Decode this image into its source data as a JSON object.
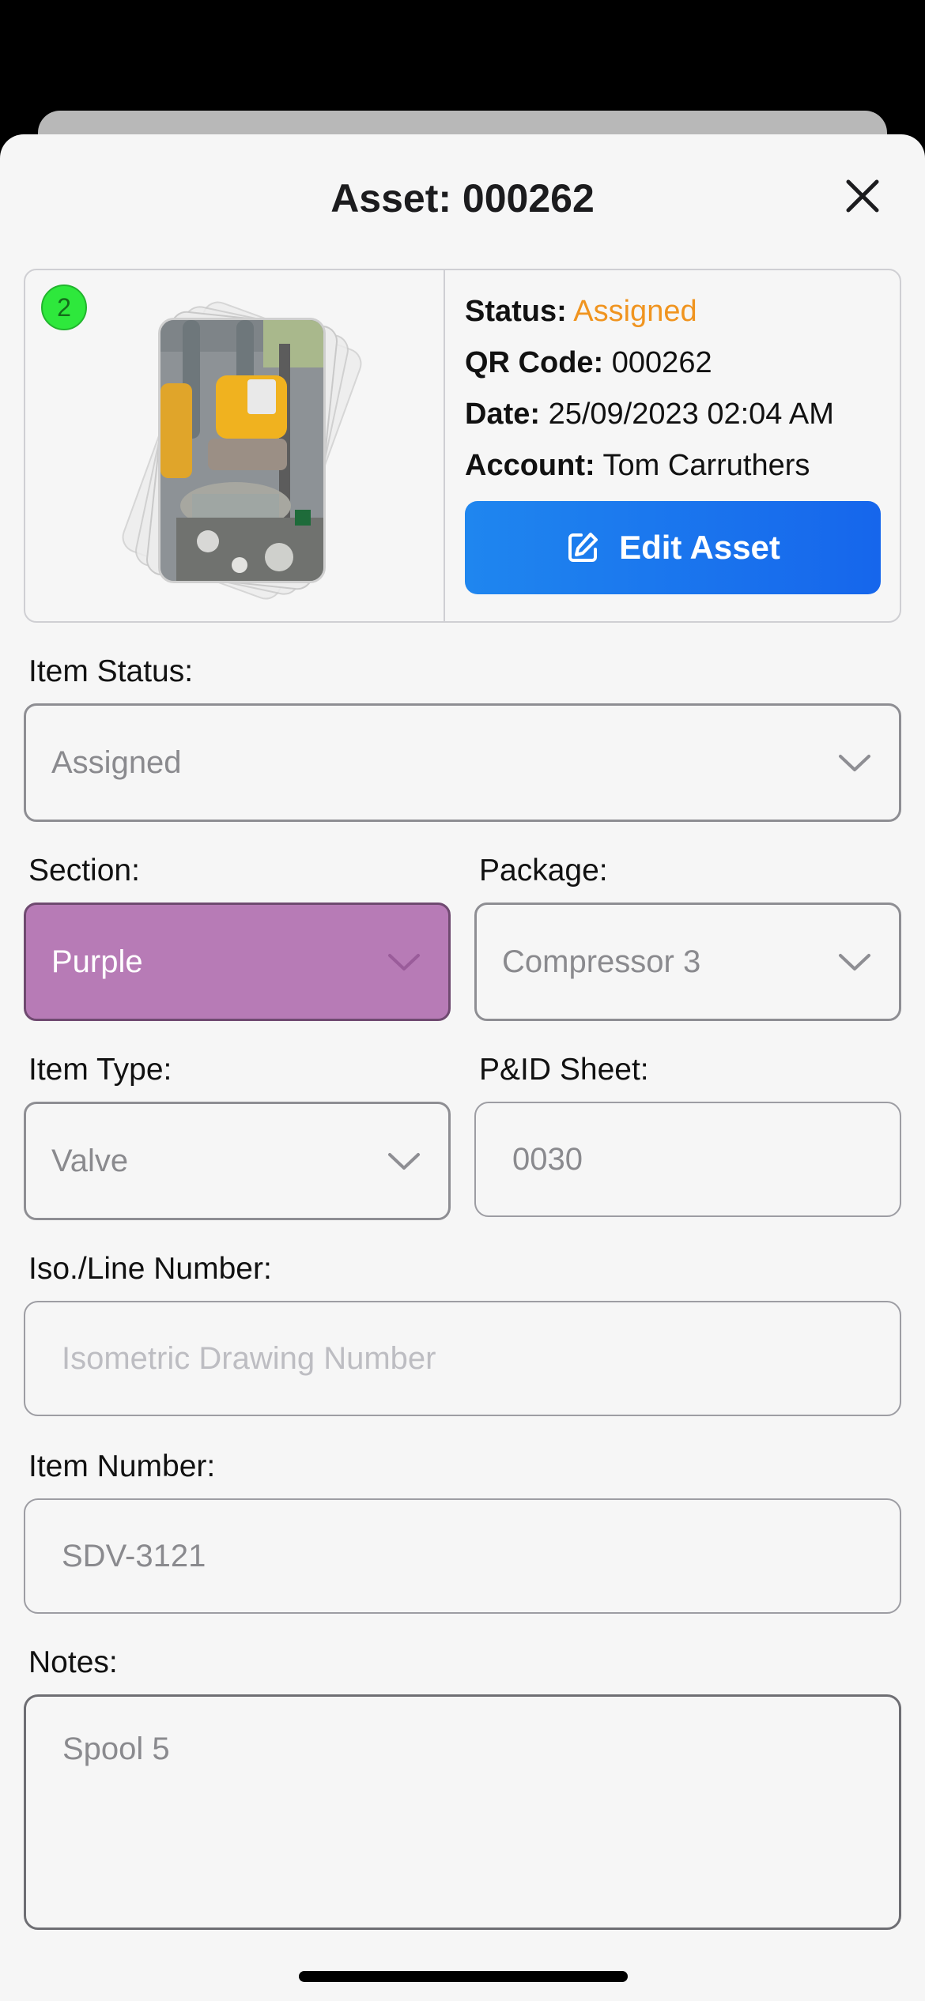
{
  "header": {
    "title": "Asset: 000262"
  },
  "asset_card": {
    "photo_count": "2",
    "status_label": "Status:",
    "status_value": "Assigned",
    "qr_label": "QR Code:",
    "qr_value": "000262",
    "date_label": "Date:",
    "date_value": "25/09/2023 02:04 AM",
    "account_label": "Account:",
    "account_value": "Tom Carruthers",
    "edit_button": "Edit Asset"
  },
  "form": {
    "item_status": {
      "label": "Item Status:",
      "value": "Assigned"
    },
    "section": {
      "label": "Section:",
      "value": "Purple"
    },
    "package": {
      "label": "Package:",
      "value": "Compressor 3"
    },
    "item_type": {
      "label": "Item Type:",
      "value": "Valve"
    },
    "pid_sheet": {
      "label": "P&ID Sheet:",
      "value": "0030"
    },
    "iso_line": {
      "label": "Iso./Line Number:",
      "placeholder": "Isometric Drawing Number"
    },
    "item_number": {
      "label": "Item Number:",
      "value": "SDV-3121"
    },
    "notes": {
      "label": "Notes:",
      "value": "Spool 5"
    }
  },
  "colors": {
    "accent": "#1f7aee",
    "status_assigned": "#f0941f",
    "section_purple": "#b77bb6",
    "badge_green": "#2ee83c"
  },
  "icons": {
    "close": "close-icon",
    "edit": "edit-icon",
    "chevron": "chevron-down-icon"
  }
}
